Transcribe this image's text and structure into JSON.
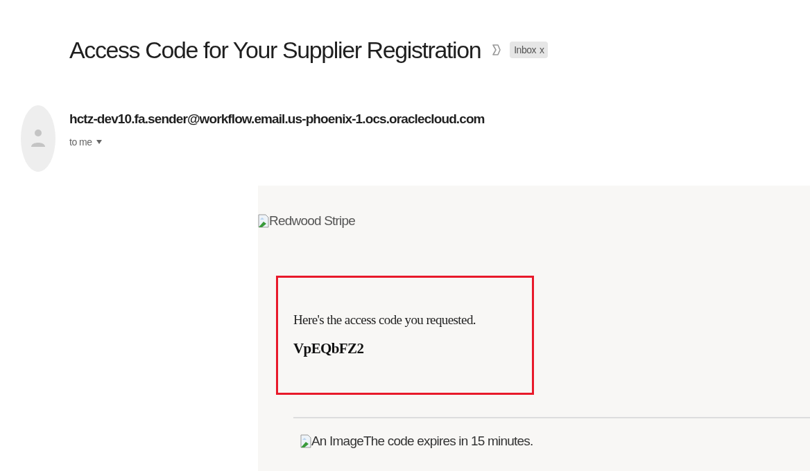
{
  "subject": "Access Code for Your Supplier Registration",
  "label": {
    "text": "Inbox",
    "close": "x"
  },
  "sender": {
    "address": "hctz-dev10.fa.sender@workflow.email.us-phoenix-1.ocs.oraclecloud.com",
    "recipient": "to me"
  },
  "body": {
    "header_image_alt": "Redwood Stripe",
    "message": "Here's the access code you requested.",
    "code": "VpEQbFZ2",
    "footer_image_alt": "An Image",
    "footer_text": "The code expires in 15 minutes."
  }
}
